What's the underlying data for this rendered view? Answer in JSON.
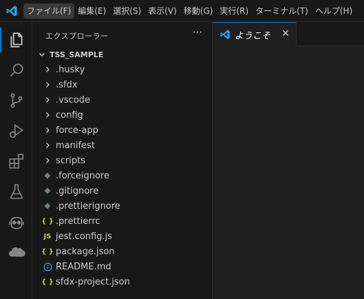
{
  "menu": [
    "ファイル(F)",
    "編集(E)",
    "選択(S)",
    "表示(V)",
    "移動(G)",
    "実行(R)",
    "ターミナル(T)",
    "ヘルプ(H)"
  ],
  "menu_active_index": 0,
  "activity_bar": [
    "explorer-icon",
    "search-icon",
    "source-control-icon",
    "run-debug-icon",
    "extensions-icon",
    "testing-icon",
    "copilot-icon",
    "salesforce-cloud-icon"
  ],
  "sidebar": {
    "title": "エクスプローラー",
    "more": "···",
    "root_label": "TSS_SAMPLE"
  },
  "tree": [
    {
      "label": ".husky",
      "kind": "folder"
    },
    {
      "label": ".sfdx",
      "kind": "folder"
    },
    {
      "label": ".vscode",
      "kind": "folder"
    },
    {
      "label": "config",
      "kind": "folder"
    },
    {
      "label": "force-app",
      "kind": "folder"
    },
    {
      "label": "manifest",
      "kind": "folder"
    },
    {
      "label": "scripts",
      "kind": "folder"
    },
    {
      "label": ".forceignore",
      "kind": "ignore"
    },
    {
      "label": ".gitignore",
      "kind": "ignore"
    },
    {
      "label": ".prettierignore",
      "kind": "ignore"
    },
    {
      "label": ".prettierrc",
      "kind": "json"
    },
    {
      "label": "jest.config.js",
      "kind": "js"
    },
    {
      "label": "package.json",
      "kind": "json"
    },
    {
      "label": "README.md",
      "kind": "info"
    },
    {
      "label": "sfdx-project.json",
      "kind": "json"
    }
  ],
  "tab": {
    "label": "ようこそ",
    "close": "✕"
  },
  "colors": {
    "accent": "#0078d4",
    "json": "#cbcb41",
    "js": "#cbcb41",
    "info": "#519aba",
    "ignore": "#6d8086"
  }
}
